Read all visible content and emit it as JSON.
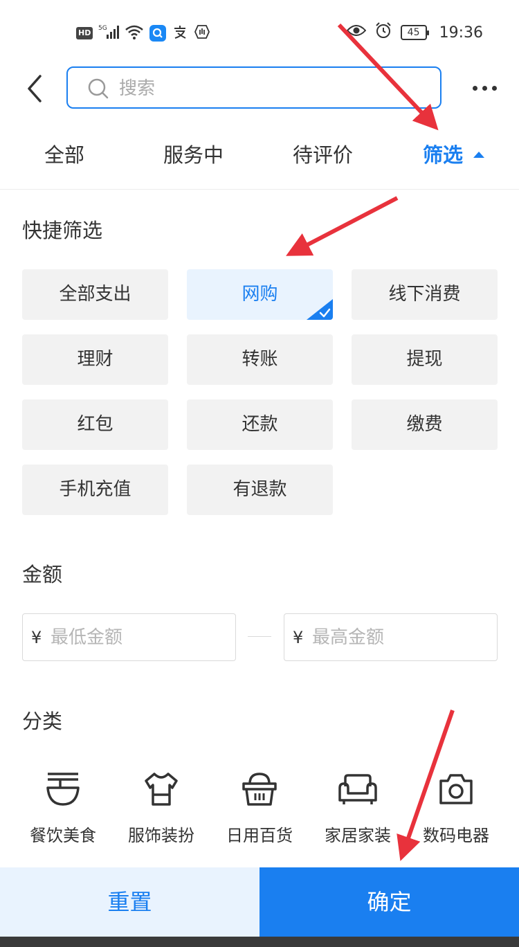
{
  "status_bar": {
    "hd": "HD",
    "signal": "5G",
    "battery": "45",
    "time": "19:36"
  },
  "search": {
    "placeholder": "搜索"
  },
  "tabs": [
    {
      "label": "全部"
    },
    {
      "label": "服务中"
    },
    {
      "label": "待评价"
    },
    {
      "label": "筛选"
    }
  ],
  "quick_filter": {
    "title": "快捷筛选",
    "chips": [
      {
        "label": "全部支出"
      },
      {
        "label": "网购",
        "selected": true
      },
      {
        "label": "线下消费"
      },
      {
        "label": "理财"
      },
      {
        "label": "转账"
      },
      {
        "label": "提现"
      },
      {
        "label": "红包"
      },
      {
        "label": "还款"
      },
      {
        "label": "缴费"
      },
      {
        "label": "手机充值"
      },
      {
        "label": "有退款"
      }
    ]
  },
  "amount": {
    "title": "金额",
    "currency": "¥",
    "min_placeholder": "最低金额",
    "max_placeholder": "最高金额"
  },
  "category": {
    "title": "分类",
    "items": [
      {
        "label": "餐饮美食",
        "icon": "bowl-icon"
      },
      {
        "label": "服饰装扮",
        "icon": "shirt-icon"
      },
      {
        "label": "日用百货",
        "icon": "basket-icon"
      },
      {
        "label": "家居家装",
        "icon": "sofa-icon"
      },
      {
        "label": "数码电器",
        "icon": "camera-icon"
      }
    ]
  },
  "footer": {
    "reset_label": "重置",
    "confirm_label": "确定"
  },
  "colors": {
    "accent": "#1a7ff0",
    "selected_bg": "#e9f3fe",
    "chip_bg": "#f2f2f2",
    "annotation_arrow": "#e8323c"
  }
}
